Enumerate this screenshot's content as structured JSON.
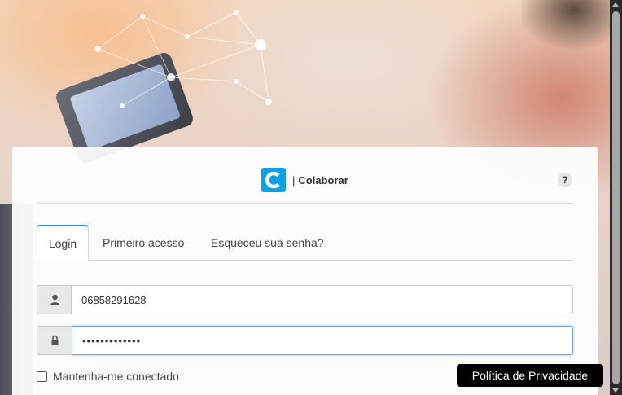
{
  "brand": {
    "separator": "|",
    "name": "Colaborar"
  },
  "help": {
    "label": "?"
  },
  "tabs": [
    {
      "label": "Login",
      "active": true
    },
    {
      "label": "Primeiro acesso",
      "active": false
    },
    {
      "label": "Esqueceu sua senha?",
      "active": false
    }
  ],
  "form": {
    "username": {
      "value": "06858291628",
      "icon": "user-icon"
    },
    "password": {
      "value": "•••••••••••••",
      "icon": "lock-icon"
    },
    "remember_label": "Mantenha-me conectado",
    "remember_checked": false
  },
  "privacy_button": {
    "label": "Política de Privacidade"
  },
  "colors": {
    "brand_blue": "#0ca0e6",
    "tab_accent": "#2d8fd5",
    "privacy_bg": "#000000"
  }
}
